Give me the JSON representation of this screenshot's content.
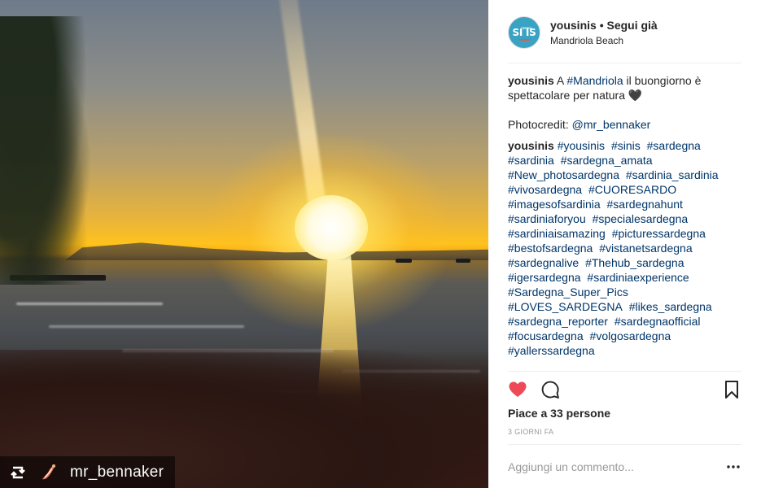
{
  "photo": {
    "credit_name": "mr_bennaker",
    "icons": [
      "repost-icon",
      "credit-logo-icon"
    ]
  },
  "header": {
    "username": "yousinis",
    "separator": "•",
    "follow_status": "Segui già",
    "location": "Mandriola Beach",
    "avatar_text": "SI IS",
    "avatar_small": "TERRA"
  },
  "caption": {
    "username": "yousinis",
    "text_before": "A ",
    "hashtag": "#Mandriola",
    "text_after": " il buongiorno è spettacolare per natura ",
    "emoji": "🖤",
    "credit_label": "Photocredit: ",
    "credit_mention": "@mr_bennaker"
  },
  "comment": {
    "username": "yousinis",
    "hashtags": [
      "#yousinis",
      "#sinis",
      "#sardegna",
      "#sardinia",
      "#sardegna_amata",
      "#New_photosardegna",
      "#sardinia_sardinia",
      "#vivosardegna",
      "#CUORESARDO",
      "#imagesofsardinia",
      "#sardegnahunt",
      "#sardiniaforyou",
      "#specialesardegna",
      "#sardiniaisamazing",
      "#picturessardegna",
      "#bestofsardegna",
      "#vistanetsardegna",
      "#sardegnalive",
      "#Thehub_sardegna",
      "#igersardegna",
      "#sardiniaexperience",
      "#Sardegna_Super_Pics",
      "#LOVES_SARDEGNA",
      "#likes_sardegna",
      "#sardegna_reporter",
      "#sardegnaofficial",
      "#focusardegna",
      "#volgosardegna",
      "#yallerssardegna"
    ]
  },
  "actions": {
    "liked": true,
    "like_color": "#ed4956",
    "icons": [
      "heart-icon",
      "comment-icon",
      "bookmark-icon"
    ]
  },
  "likes": {
    "text": "Piace a 33 persone"
  },
  "timestamp": "3 GIORNI FA",
  "add_comment": {
    "placeholder": "Aggiungi un commento...",
    "more_icon": "more-options-icon"
  },
  "colors": {
    "link": "#003569",
    "muted": "#999999",
    "text": "#262626",
    "avatar_bg": "#3aa3c4"
  }
}
